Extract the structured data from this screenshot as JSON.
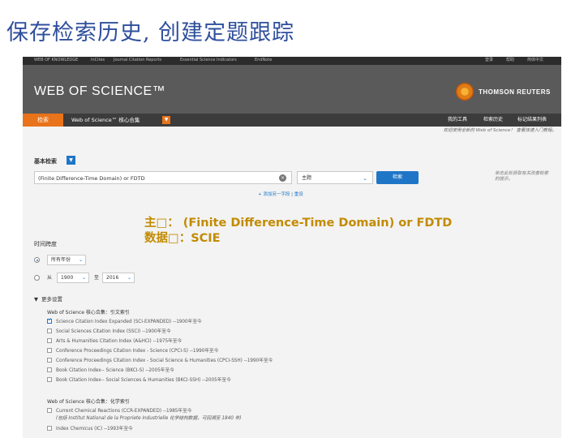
{
  "slide_title": "保存检索历史, 创建定题跟踪",
  "topbar": [
    "WEB OF KNOWLEDGE",
    "InCites",
    "Journal Citation Reports",
    "Essential Science Indicators",
    "EndNote",
    "登录",
    "帮助",
    "简体中文"
  ],
  "brand": {
    "wos_logo": "WEB OF SCIENCE™",
    "publisher": "THOMSON REUTERS"
  },
  "nav": {
    "search_tab": "检索",
    "core_collection": "Web of Science™ 核心合集",
    "my_tools": "我的工具",
    "search_history": "检索历史",
    "marked_list": "标记结果列表"
  },
  "welcome": "欢迎使用全新的 Web of Science！ 查看快速入门教程。",
  "basic_search": {
    "label": "基本检索",
    "query": "(Finite Difference-Time Domain) or FDTD",
    "field": "主题",
    "search_button": "检索",
    "tip": "单击此处获取有关改善检索的提示。",
    "add_field": "+ 添加另一字段 | 重设"
  },
  "overlay": {
    "line1": "主□： (Finite Difference-Time Domain) or FDTD",
    "line2": "数据□：SCIE"
  },
  "timespan": {
    "label": "时间跨度",
    "all_years": "所有年份",
    "from_label": "从",
    "from_year": "1900",
    "to_label": "至",
    "to_year": "2016"
  },
  "more_settings": {
    "label": "更多设置",
    "citation_head": "Web of Science 核心合集：引文索引",
    "citation_indexes": [
      {
        "label": "Science Citation Index Expanded (SCI-EXPANDED) --1900年至今",
        "checked": true
      },
      {
        "label": "Social Sciences Citation Index (SSCI) --1900年至今",
        "checked": false
      },
      {
        "label": "Arts & Humanities Citation Index (A&HCI) --1975年至今",
        "checked": false
      },
      {
        "label": "Conference Proceedings Citation Index - Science (CPCI-S) --1990年至今",
        "checked": false
      },
      {
        "label": "Conference Proceedings Citation Index - Social Science & Humanities (CPCI-SSH) --1990年至今",
        "checked": false
      },
      {
        "label": "Book Citation Index-- Science (BKCI-S) --2005年至今",
        "checked": false
      },
      {
        "label": "Book Citation Index-- Social Sciences & Humanities (BKCI-SSH) --2005年至今",
        "checked": false
      }
    ],
    "chem_head": "Web of Science 核心合集：化学索引",
    "chem_indexes": [
      {
        "label": "Current Chemical Reactions (CCR-EXPANDED) --1985年至今",
        "checked": false,
        "note": "(包括 Institut National de la Propriete Industrielle 化学结构数据，可回溯至 1840 年)"
      },
      {
        "label": "Index Chemicus (IC) --1993年至今",
        "checked": false
      }
    ]
  },
  "colors": {
    "title": "#2f4f9c",
    "accent_orange": "#e8731a",
    "link_blue": "#1f76c6",
    "overlay": "#c28b00"
  }
}
